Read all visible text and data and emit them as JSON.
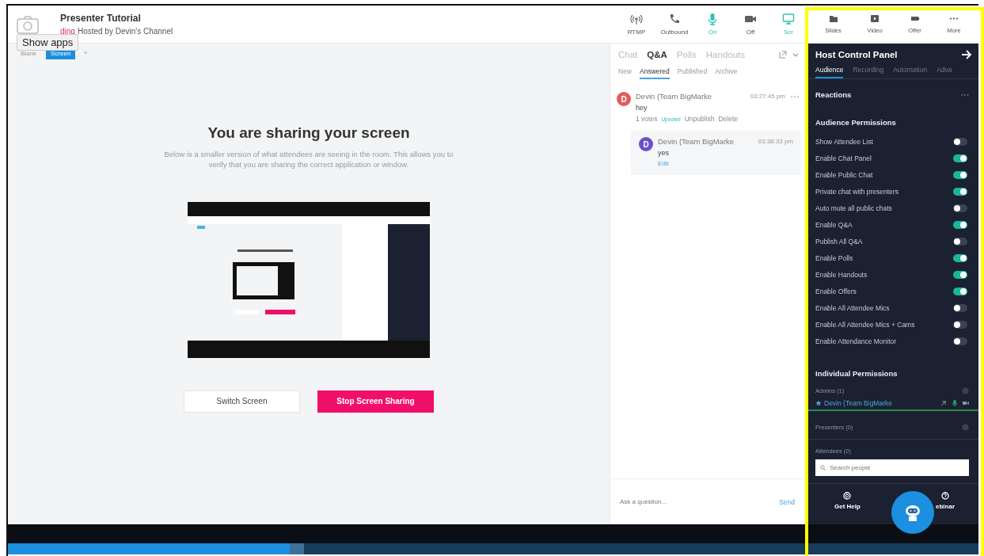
{
  "window": {
    "title": "Presenter Tutorial",
    "status": "ding",
    "host": "Hosted by Devin's Channel",
    "tooltip": "Show apps"
  },
  "toolbar": [
    {
      "label": "RTMP",
      "active": false
    },
    {
      "label": "Outbound",
      "active": false
    },
    {
      "label": "On",
      "active": true
    },
    {
      "label": "Off",
      "active": false
    },
    {
      "label": "Scr",
      "active": true
    }
  ],
  "panel_toolbar": [
    {
      "label": "Slides"
    },
    {
      "label": "Video"
    },
    {
      "label": "Offer"
    },
    {
      "label": "More"
    }
  ],
  "stage_tabs": [
    {
      "label": "Blank",
      "selected": false
    },
    {
      "label": "Screen",
      "selected": true
    }
  ],
  "add_button": "+",
  "stage": {
    "heading": "You are sharing your screen",
    "description": "Below is a smaller version of what attendees are seeing in the room. This allows you to verify that you are sharing the correct application or window.",
    "buttons": [
      {
        "label": "Switch Screen",
        "kind": "secondary"
      },
      {
        "label": "Stop Screen Sharing",
        "kind": "primary"
      }
    ]
  },
  "qa": {
    "tabs": [
      {
        "label": "Chat",
        "selected": false
      },
      {
        "label": "Q&A",
        "selected": true
      },
      {
        "label": "Polls",
        "selected": false
      },
      {
        "label": "Handouts",
        "selected": false
      }
    ],
    "subtabs": [
      {
        "label": "New",
        "selected": false
      },
      {
        "label": "Answered",
        "selected": true
      },
      {
        "label": "Published",
        "selected": false
      },
      {
        "label": "Archive",
        "selected": false
      }
    ],
    "questions": [
      {
        "avatar": "D",
        "color": "#e25c5c",
        "author": "Devin (Team BigMarke",
        "time": "03:27:45 pm",
        "text": "hey",
        "votes": "1 votes",
        "badge": "Upvoted",
        "actions": [
          "Unpublish",
          "Delete"
        ],
        "reply": {
          "avatar": "D",
          "color": "#6b4fc9",
          "author": "Devin (Team BigMarke",
          "time": "03:38:33 pm",
          "text": "yes",
          "action": "Edit"
        }
      }
    ],
    "input": {
      "placeholder": "Ask a question...",
      "send": "Send"
    }
  },
  "host_panel": {
    "title": "Host Control Panel",
    "tabs": [
      {
        "label": "Audience",
        "selected": true
      },
      {
        "label": "Recording",
        "selected": false
      },
      {
        "label": "Automation",
        "selected": false
      },
      {
        "label": "Adva",
        "selected": false
      }
    ],
    "reactions": "Reactions",
    "audience_heading": "Audience Permissions",
    "permissions": [
      {
        "label": "Show Attendee List",
        "on": false
      },
      {
        "label": "Enable Chat Panel",
        "on": true
      },
      {
        "label": "Enable Public Chat",
        "on": true
      },
      {
        "label": "Private chat with presenters",
        "on": true
      },
      {
        "label": "Auto mute all public chats",
        "on": false
      },
      {
        "label": "Enable Q&A",
        "on": true
      },
      {
        "label": "Publish All Q&A",
        "on": false
      },
      {
        "label": "Enable Polls",
        "on": true
      },
      {
        "label": "Enable Handouts",
        "on": true
      },
      {
        "label": "Enable Offers",
        "on": true
      },
      {
        "label": "Enable All Attendee Mics",
        "on": false
      },
      {
        "label": "Enable All Attendee Mics + Cams",
        "on": false
      },
      {
        "label": "Enable Attendance Monitor",
        "on": false
      }
    ],
    "individual_heading": "Individual Permissions",
    "admins": {
      "label": "Admins (1)",
      "members": [
        {
          "name": "Devin (Team BigMarke"
        }
      ]
    },
    "presenters": "Presenters (0)",
    "attendees": "Attendees (0)",
    "search": {
      "placeholder": "Search people"
    },
    "footer": [
      {
        "label": "Get Help"
      },
      {
        "label": "ebinar"
      }
    ]
  },
  "player": {
    "level": 0.29
  }
}
